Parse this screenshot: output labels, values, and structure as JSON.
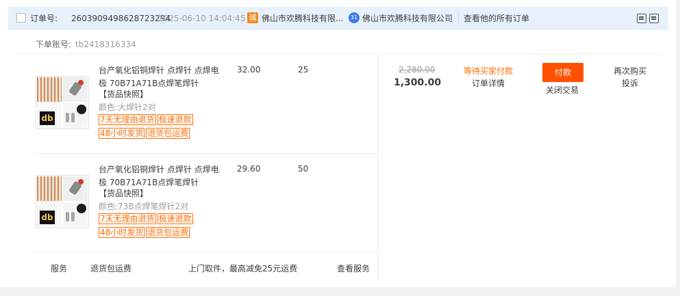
{
  "header": {
    "order_label": "订单号:",
    "order_number": "2603909498628723294",
    "order_time": "2025-06-10 14:04:45",
    "shop_icon": "天猫诚",
    "shop_name": "佛山市欢腾科技有限...",
    "wangwang_icon": "chat-icon",
    "seller_name": "佛山市欢腾科技有限公司",
    "view_all_orders": "查看他的所有订单"
  },
  "account": {
    "label": "下单账号:",
    "value": "tb2418316334"
  },
  "items": [
    {
      "title": "台产氧化铝铜焊针 点焊针 点焊电极 70B71A71B点焊笔焊针",
      "snapshot": "【货品快照】",
      "spec": "颜色:大焊针2对",
      "price": "32.00",
      "quantity": "25",
      "tags": [
        "7天无理由退货",
        "极速退款",
        "48小时发货",
        "退货包运费"
      ]
    },
    {
      "title": "台产氧化铝铜焊针 点焊针 点焊电极 70B71A71B点焊笔焊针",
      "snapshot": "【货品快照】",
      "spec": "颜色:73B点焊笔焊针2对",
      "price": "29.60",
      "quantity": "50",
      "tags": [
        "7天无理由退货",
        "极速退款",
        "48小时发货",
        "退货包运费"
      ]
    }
  ],
  "service": {
    "label": "服务",
    "name": "退货包运费",
    "description": "上门取件，最高减免25元运费",
    "link": "查看服务"
  },
  "summary": {
    "original_price": "2,280.00",
    "total_price": "1,300.00",
    "status": "等待买家付款",
    "detail_link": "订单详情",
    "pay_button": "付款",
    "close_link": "关闭交易",
    "rebuy_link": "再次购买",
    "complain_link": "投诉"
  },
  "colors": {
    "accent": "#ff5000",
    "tag": "#ff6a00",
    "header_bg": "#e8f1fb"
  }
}
